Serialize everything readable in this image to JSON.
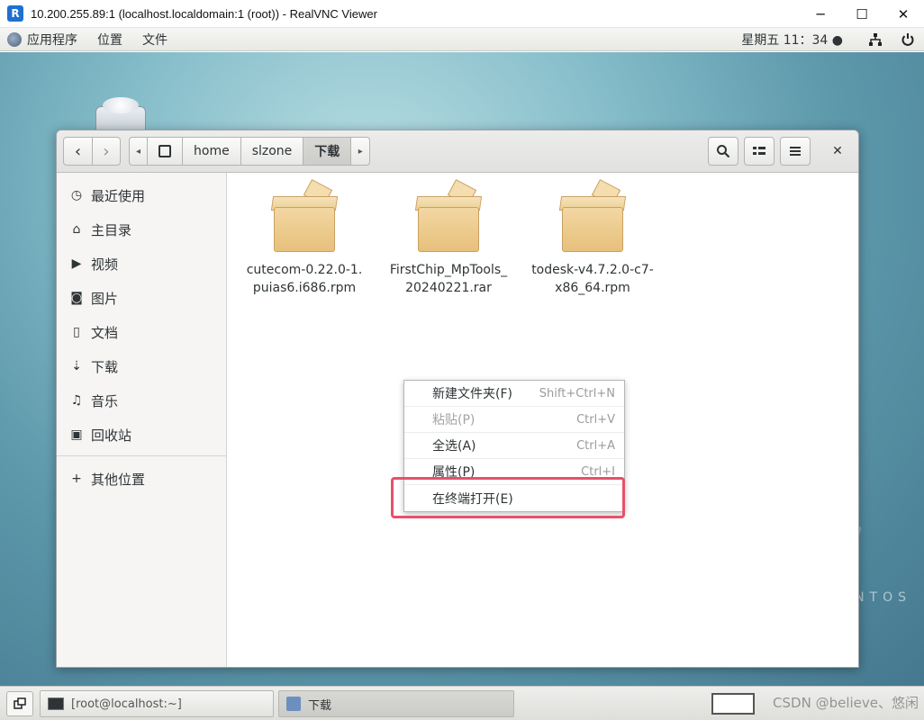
{
  "vnc": {
    "title": "10.200.255.89:1 (localhost.localdomain:1 (root)) - RealVNC Viewer",
    "logo_letter": "R",
    "minimize": "─",
    "maximize": "☐",
    "close": "✕"
  },
  "panel": {
    "menus": [
      "应用程序",
      "位置",
      "文件"
    ],
    "clock": "星期五 11：34 ●",
    "network_icon": "network-icon",
    "power_icon": "power-icon"
  },
  "desktop": {
    "centos_text": "NTOS",
    "watermark": "CSDN @believe、悠闲"
  },
  "nautilus": {
    "path": [
      "home",
      "slzone",
      "下载"
    ],
    "back": "‹",
    "forward": "›",
    "left_arrow": "◂",
    "right_arrow": "▸",
    "close": "✕"
  },
  "sidebar": {
    "items": [
      {
        "label": "最近使用",
        "icon": "clock-icon",
        "glyph": "◷"
      },
      {
        "label": "主目录",
        "icon": "home-icon",
        "glyph": "⌂"
      },
      {
        "label": "视频",
        "icon": "video-icon",
        "glyph": "▶"
      },
      {
        "label": "图片",
        "icon": "camera-icon",
        "glyph": "◙"
      },
      {
        "label": "文档",
        "icon": "document-icon",
        "glyph": "▯"
      },
      {
        "label": "下载",
        "icon": "download-icon",
        "glyph": "⇣"
      },
      {
        "label": "音乐",
        "icon": "music-icon",
        "glyph": "♫"
      },
      {
        "label": "回收站",
        "icon": "trash-icon",
        "glyph": "▣"
      }
    ],
    "other_locations": "其他位置",
    "other_glyph": "+"
  },
  "files": [
    {
      "line1": "cutecom-0.22.0-1.",
      "line2": "puias6.i686.rpm"
    },
    {
      "line1": "FirstChip_MpTools_",
      "line2": "20240221.rar"
    },
    {
      "line1": "todesk-v4.7.2.0-c7-",
      "line2": "x86_64.rpm"
    }
  ],
  "context_menu": {
    "items": [
      {
        "label": "新建文件夹(F)",
        "accel": "Shift+Ctrl+N",
        "enabled": true
      },
      {
        "label": "粘贴(P)",
        "accel": "Ctrl+V",
        "enabled": false
      },
      {
        "label": "全选(A)",
        "accel": "Ctrl+A",
        "enabled": true
      },
      {
        "label": "属性(P)",
        "accel": "Ctrl+I",
        "enabled": true
      },
      {
        "label": "在终端打开(E)",
        "accel": "",
        "enabled": true
      }
    ],
    "highlight_color": "#e8506b"
  },
  "taskbar": {
    "terminal_label": "[root@localhost:~]",
    "files_label": "下载"
  }
}
